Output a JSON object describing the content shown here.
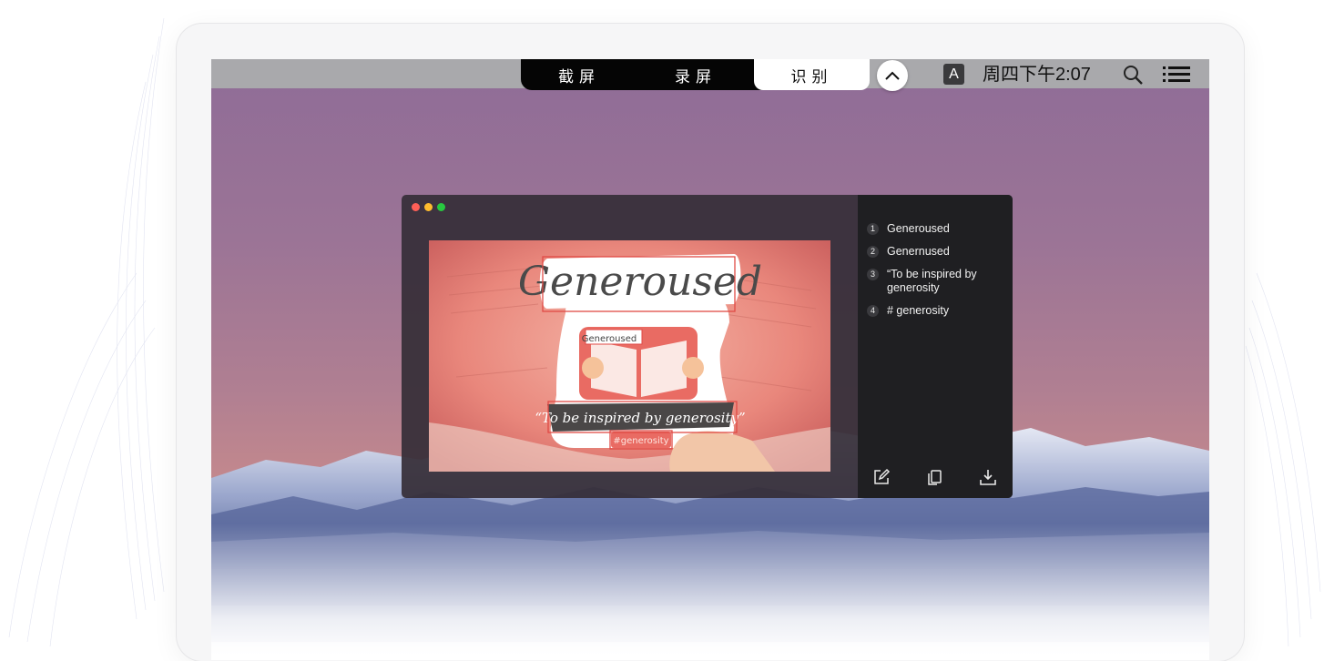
{
  "menubar": {
    "tabs": [
      {
        "label": "截屏",
        "active": false
      },
      {
        "label": "录屏",
        "active": false
      },
      {
        "label": "识别",
        "active": true
      }
    ],
    "collapse_icon": "chevron-up-icon",
    "input_method_label": "A",
    "clock": "周四下午2:07",
    "search_icon": "search-icon",
    "list_icon": "list-menu-icon"
  },
  "window": {
    "traffic_lights": [
      "#fe5f57",
      "#febc2e",
      "#28c840"
    ],
    "image": {
      "sticker_title": "Generoused",
      "sticker_small": "Generoused",
      "banner_text": "“To be inspired by generosity”",
      "tag_text": "#generosity"
    },
    "results": [
      {
        "num": "1",
        "text": "Generoused"
      },
      {
        "num": "2",
        "text": "Genernused"
      },
      {
        "num": "3",
        "text": "“To be inspired by generosity"
      },
      {
        "num": "4",
        "text": "# generosity"
      }
    ],
    "actions": [
      "edit-icon",
      "copy-icon",
      "download-icon"
    ]
  },
  "colors": {
    "menubar": "#a9a9ac",
    "segment_bg": "#050505",
    "panel_bg": "#1f1f22",
    "highlight_box": "#e04a45"
  }
}
